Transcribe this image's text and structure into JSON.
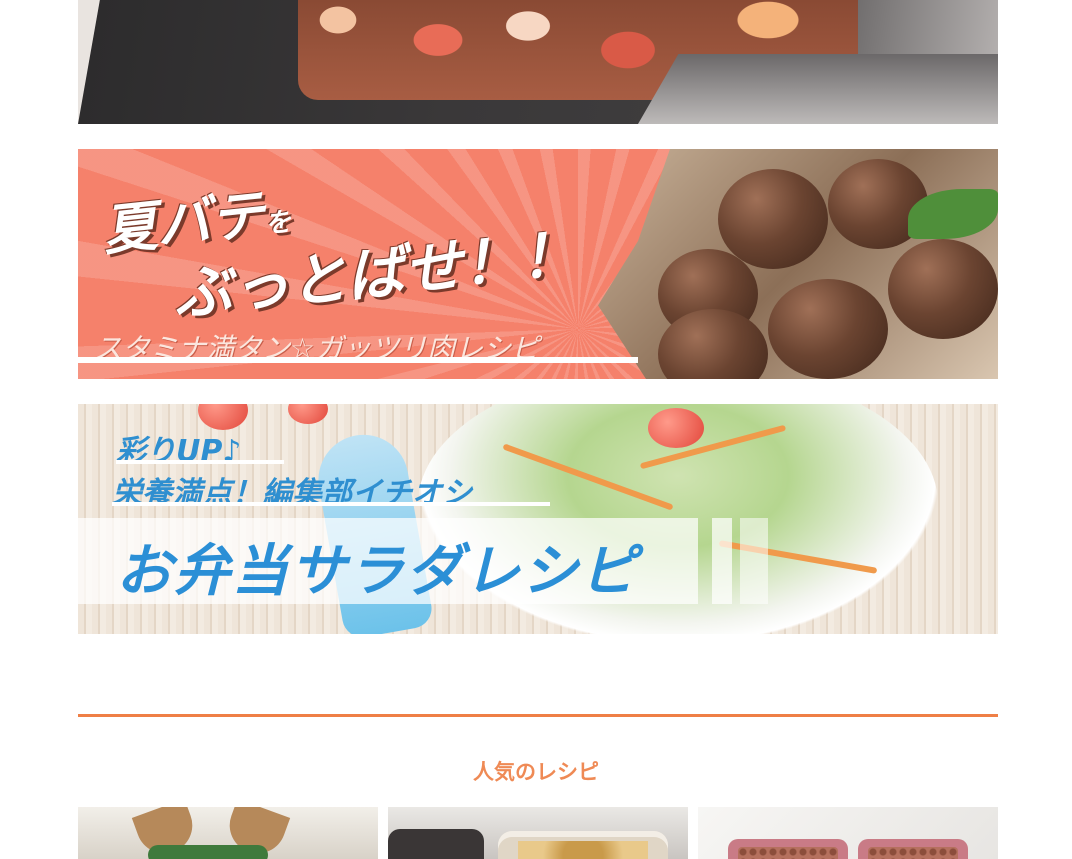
{
  "banners": {
    "meat": {
      "line1_main": "夏バテ",
      "line1_particle": "を",
      "line2": "ぶっとばせ！！",
      "subtitle": "スタミナ満タン☆ガッツリ肉レシピ"
    },
    "salad": {
      "line1": "彩りUP♪",
      "line2": "栄養満点！編集部イチオシ",
      "title": "お弁当サラダレシピ"
    }
  },
  "section": {
    "popular_title": "人気のレシピ"
  },
  "colors": {
    "accent_orange": "#ef7f46",
    "meat_banner_bg": "#f5816b",
    "salad_blue": "#2b8fd6"
  }
}
